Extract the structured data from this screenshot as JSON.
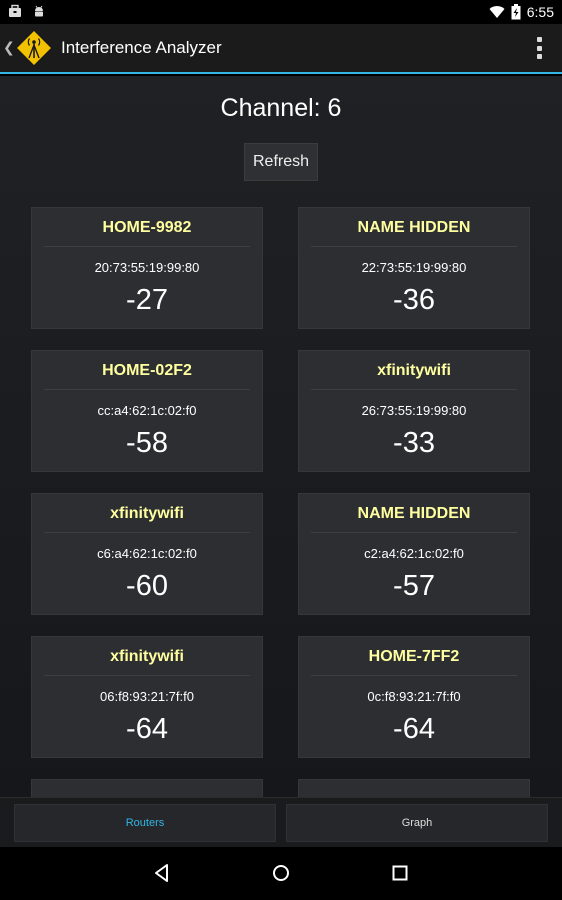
{
  "status_bar": {
    "time": "6:55"
  },
  "action_bar": {
    "title": "Interference Analyzer"
  },
  "main": {
    "channel_label": "Channel: 6",
    "refresh_label": "Refresh",
    "routers": [
      {
        "ssid": "HOME-9982",
        "mac": "20:73:55:19:99:80",
        "rssi": "-27"
      },
      {
        "ssid": "NAME HIDDEN",
        "mac": "22:73:55:19:99:80",
        "rssi": "-36"
      },
      {
        "ssid": "HOME-02F2",
        "mac": "cc:a4:62:1c:02:f0",
        "rssi": "-58"
      },
      {
        "ssid": "xfinitywifi",
        "mac": "26:73:55:19:99:80",
        "rssi": "-33"
      },
      {
        "ssid": "xfinitywifi",
        "mac": "c6:a4:62:1c:02:f0",
        "rssi": "-60"
      },
      {
        "ssid": "NAME HIDDEN",
        "mac": "c2:a4:62:1c:02:f0",
        "rssi": "-57"
      },
      {
        "ssid": "xfinitywifi",
        "mac": "06:f8:93:21:7f:f0",
        "rssi": "-64"
      },
      {
        "ssid": "HOME-7FF2",
        "mac": "0c:f8:93:21:7f:f0",
        "rssi": "-64"
      }
    ]
  },
  "tabs": {
    "routers": "Routers",
    "graph": "Graph"
  },
  "colors": {
    "accent": "#33b5e5",
    "ssid": "#ffffa0"
  }
}
